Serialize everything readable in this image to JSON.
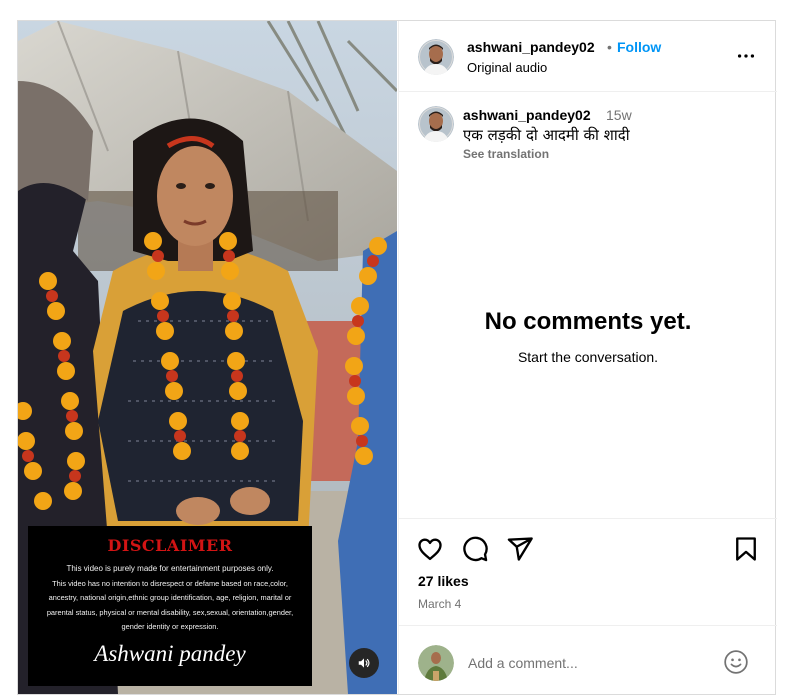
{
  "post": {
    "username": "ashwani_pandey02",
    "follow_label": "Follow",
    "separator": "•",
    "audio": "Original audio",
    "caption_age": "15w",
    "caption": "एक लड़की दो आदमी की शादी",
    "see_translation": "See translation",
    "likes": "27 likes",
    "date": "March 4"
  },
  "comments": {
    "empty_title": "No comments yet.",
    "empty_sub": "Start the conversation.",
    "placeholder": "Add a comment..."
  },
  "disclaimer": {
    "title": "DISCLAIMER",
    "lines": [
      "This video is purely made for entertainment purposes only.",
      "This video has no intention to disrespect or defame based on race,color,",
      "ancestry, national origin,ethnic group identification, age, religion, marital or",
      "parental status, physical or mental disability, sex,sexual, orientation,gender,",
      "gender identity or expression."
    ],
    "signature": "Ashwani pandey"
  },
  "icons": {
    "more": "more-options-icon",
    "like": "heart-icon",
    "comment": "comment-icon",
    "share": "share-icon",
    "save": "bookmark-icon",
    "emoji": "emoji-icon",
    "sound": "speaker-icon"
  },
  "colors": {
    "follow": "#0095f6",
    "muted_text": "#737373",
    "disclaimer_title": "#d21414",
    "border": "#dbdbdb"
  }
}
